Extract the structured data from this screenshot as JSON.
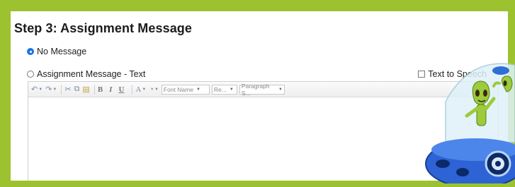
{
  "heading": "Step 3: Assignment Message",
  "options": {
    "no_message": "No Message",
    "text_message": "Assignment Message - Text",
    "tts": "Text to Speech"
  },
  "toolbar": {
    "font_name": "Font Name",
    "size": "Re...",
    "paragraph": "Paragraph S..."
  },
  "colors": {
    "frame": "#9cc32f",
    "radio": "#1a73e8"
  },
  "icons": [
    "undo-icon",
    "redo-icon",
    "cut-icon",
    "copy-icon",
    "paste-icon",
    "font-color-icon",
    "highlight-icon"
  ]
}
